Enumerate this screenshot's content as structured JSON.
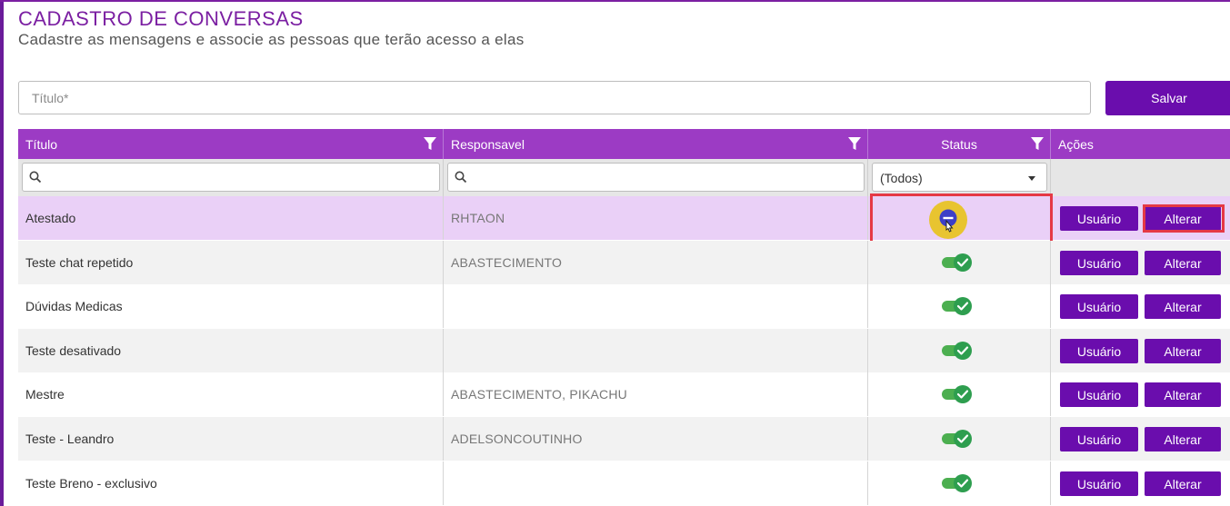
{
  "page": {
    "title": "CADASTRO DE CONVERSAS",
    "subtitle": "Cadastre as mensagens e associe as pessoas que terão acesso a elas"
  },
  "form": {
    "title_placeholder": "Título*",
    "title_value": "",
    "save_label": "Salvar"
  },
  "colors": {
    "brand_purple": "#6a0dad",
    "header_purple": "#9c3bc4",
    "selected_row": "#ead0f7",
    "toggle_on": "#2e9e4f",
    "highlight_red": "#e53945",
    "cursor_yellow": "#e8c21a"
  },
  "table": {
    "headers": {
      "title": "Título",
      "responsible": "Responsavel",
      "status": "Status",
      "actions": "Ações"
    },
    "status_filter_value": "(Todos)",
    "action_labels": {
      "user": "Usuário",
      "edit": "Alterar"
    },
    "rows": [
      {
        "title": "Atestado",
        "responsible": "RHTAON",
        "status": "indeterminate",
        "selected": true
      },
      {
        "title": "Teste chat repetido",
        "responsible": "ABASTECIMENTO",
        "status": "on"
      },
      {
        "title": "Dúvidas Medicas",
        "responsible": "",
        "status": "on"
      },
      {
        "title": "Teste desativado",
        "responsible": "",
        "status": "on"
      },
      {
        "title": "Mestre",
        "responsible": "ABASTECIMENTO, PIKACHU",
        "status": "on"
      },
      {
        "title": "Teste - Leandro",
        "responsible": "ADELSONCOUTINHO",
        "status": "on"
      },
      {
        "title": "Teste Breno - exclusivo",
        "responsible": "",
        "status": "on"
      }
    ]
  },
  "icons": [
    "filter-icon",
    "search-icon",
    "chevron-down-icon",
    "check-icon",
    "minus-icon",
    "hand-cursor-icon"
  ]
}
